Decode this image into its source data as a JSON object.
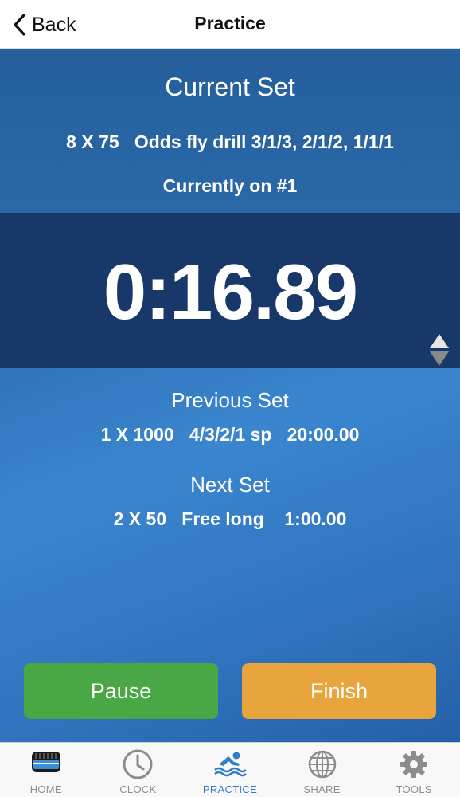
{
  "navbar": {
    "back_label": "Back",
    "title": "Practice"
  },
  "current_set": {
    "heading": "Current Set",
    "description": "8 X 75   Odds fly drill 3/1/3, 2/1/2, 1/1/1",
    "position": "Currently on #1"
  },
  "timer": {
    "value": "0:16.89"
  },
  "previous_set": {
    "heading": "Previous Set",
    "detail": "1 X 1000   4/3/2/1 sp   20:00.00"
  },
  "next_set": {
    "heading": "Next Set",
    "detail": "2 X 50   Free long    1:00.00"
  },
  "buttons": {
    "pause": "Pause",
    "finish": "Finish"
  },
  "tabbar": {
    "active": "PRACTICE",
    "tabs": [
      {
        "label": "HOME",
        "icon": "home-icon"
      },
      {
        "label": "CLOCK",
        "icon": "clock-icon"
      },
      {
        "label": "PRACTICE",
        "icon": "swimmer-icon"
      },
      {
        "label": "SHARE",
        "icon": "globe-icon"
      },
      {
        "label": "TOOLS",
        "icon": "gear-icon"
      }
    ]
  },
  "colors": {
    "accent_blue": "#2f7dc6",
    "timer_band": "#18386a",
    "pause_green": "#4aa745",
    "finish_orange": "#e8a53d"
  }
}
